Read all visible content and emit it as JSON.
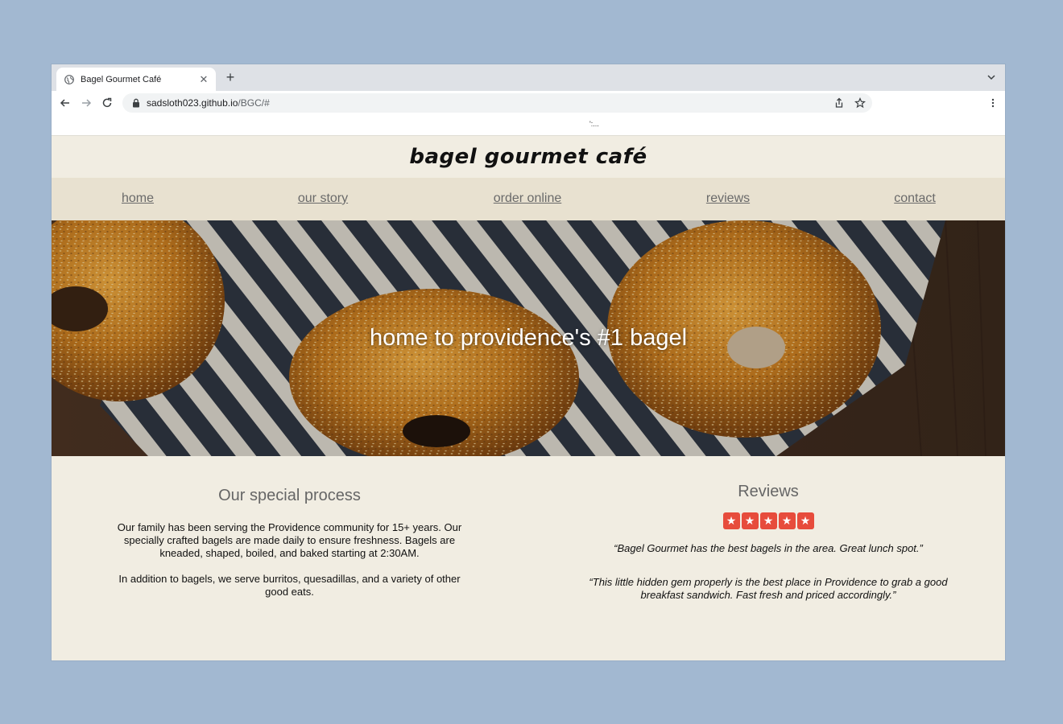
{
  "browser": {
    "tab_title": "Bagel Gourmet Café",
    "tab_close": "✕",
    "new_tab": "+",
    "url_host": "sadsloth023.github.io",
    "url_path": "/BGC/#"
  },
  "page": {
    "top_dots": "':..."
  },
  "site": {
    "brand": "bagel gourmet café"
  },
  "nav": {
    "home": "home",
    "our_story": "our story",
    "order_online": "order online",
    "reviews": "reviews",
    "contact": "contact"
  },
  "hero": {
    "headline": "home to providence's #1 bagel"
  },
  "process": {
    "title": "Our special process",
    "para1": "Our family has been serving the Providence community for 15+ years. Our specially crafted bagels are made daily to ensure freshness. Bagels are kneaded, shaped, boiled, and baked starting at 2:30AM.",
    "para2": "In addition to bagels, we serve burritos, quesadillas, and a variety of other good eats."
  },
  "reviews": {
    "title": "Reviews",
    "rating": 5,
    "star_glyph": "★",
    "quote1": "“Bagel Gourmet has the best bagels in the area. Great lunch spot.”",
    "quote2": "“This little hidden gem properly is the best place in Providence to grab a good breakfast sandwich. Fast fresh and priced accordingly.”"
  },
  "colors": {
    "background": "#a2b8d1",
    "page_bg": "#f1ede2",
    "nav_bg": "#e8e1d0",
    "star_red": "#e74c3c"
  }
}
